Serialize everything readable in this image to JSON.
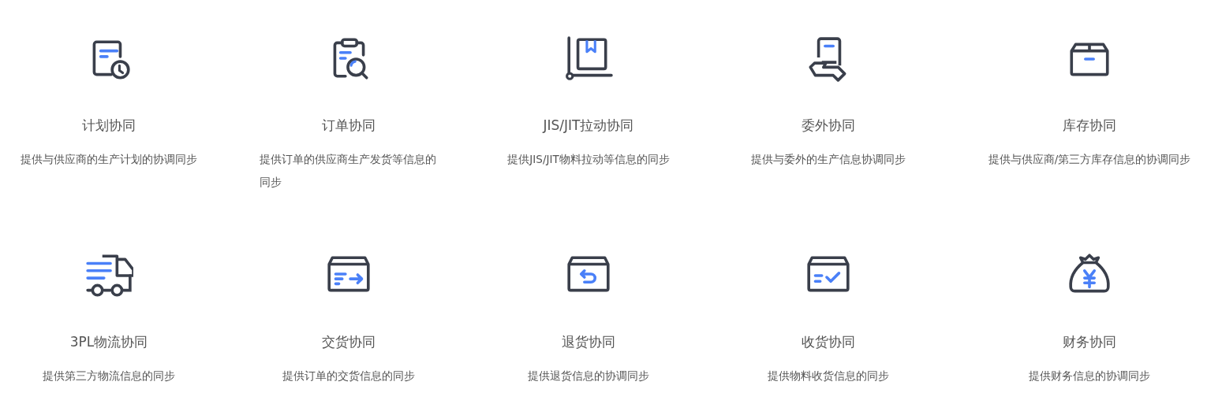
{
  "features": [
    {
      "title": "计划协同",
      "description": "提供与供应商的生产计划的协调同步"
    },
    {
      "title": "订单协同",
      "description": "提供订单的供应商生产发货等信息的同步"
    },
    {
      "title": "JIS/JIT拉动协同",
      "description": "提供JIS/JIT物料拉动等信息的同步"
    },
    {
      "title": "委外协同",
      "description": "提供与委外的生产信息协调同步"
    },
    {
      "title": "库存协同",
      "description": "提供与供应商/第三方库存信息的协调同步"
    },
    {
      "title": "3PL物流协同",
      "description": "提供第三方物流信息的同步"
    },
    {
      "title": "交货协同",
      "description": "提供订单的交货信息的同步"
    },
    {
      "title": "退货协同",
      "description": "提供退货信息的协调同步"
    },
    {
      "title": "收货协同",
      "description": "提供物料收货信息的同步"
    },
    {
      "title": "财务协同",
      "description": "提供财务信息的协调同步"
    }
  ]
}
